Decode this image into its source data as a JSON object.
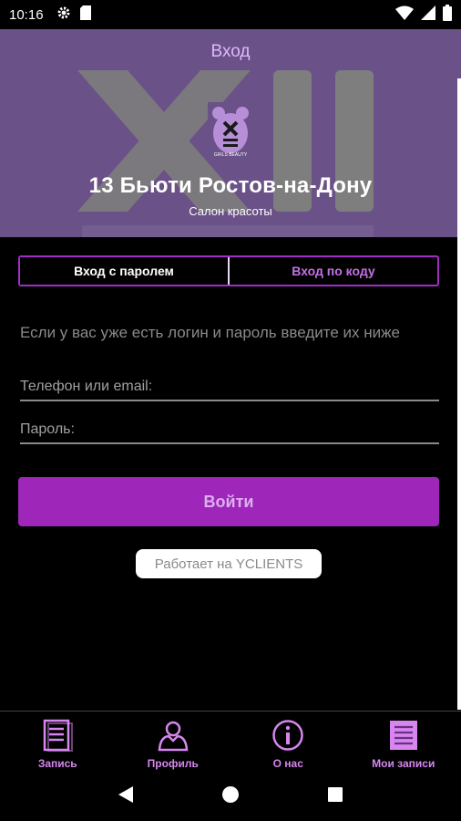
{
  "status_bar": {
    "time": "10:16",
    "icons": [
      "gear-icon",
      "sim-icon"
    ],
    "right_icons": [
      "wifi-icon",
      "signal-icon",
      "battery-icon"
    ]
  },
  "header": {
    "title": "Вход",
    "salon_name": "13 Бьюти Ростов-на-Дону",
    "salon_subtitle": "Салон красоты",
    "logo_text": "GIRLS BEAUTY",
    "background_color": "#6a5187",
    "title_color": "#e0b7ff"
  },
  "tabs": [
    {
      "label": "Вход с паролем",
      "active": true
    },
    {
      "label": "Вход по коду",
      "active": false
    }
  ],
  "form": {
    "hint": "Если у вас уже есть логин и пароль введите их ниже",
    "phone_placeholder": "Телефон или email:",
    "password_placeholder": "Пароль:",
    "submit_label": "Войти"
  },
  "powered_by": "Работает на YCLIENTS",
  "bottom_nav": {
    "items": [
      {
        "label": "Запись",
        "icon": "document-icon"
      },
      {
        "label": "Профиль",
        "icon": "person-icon"
      },
      {
        "label": "О нас",
        "icon": "info-icon"
      },
      {
        "label": "Мои записи",
        "icon": "list-icon"
      }
    ]
  },
  "system_nav": [
    "back-icon",
    "home-icon",
    "recents-icon"
  ],
  "colors": {
    "accent": "#9e27ba",
    "accent_text": "#d786f0",
    "background": "#000000"
  }
}
